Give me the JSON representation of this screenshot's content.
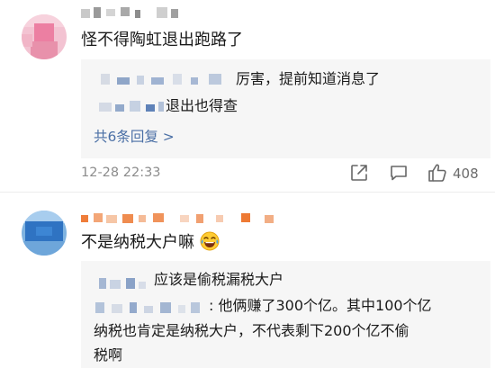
{
  "comments": [
    {
      "text": "怪不得陶虹退出跑路了",
      "replies": [
        {
          "text": "厉害，提前知道消息了"
        },
        {
          "text": "退出也得查"
        }
      ],
      "more_replies": "共6条回复 >",
      "time": "12-28 22:33",
      "likes": "408"
    },
    {
      "text": "不是纳税大户嘛",
      "emoji": "tears-of-joy-emoji",
      "replies": [
        {
          "line1": "应该是偷税漏税大户",
          "line2": ": 他俩赚了300个亿。其中100个亿",
          "line3": "纳税也肯定是纳税大户，不代表剩下200个亿不偷",
          "line4": "税啊"
        }
      ]
    }
  ],
  "icons": [
    "share-icon",
    "comment-icon",
    "like-icon"
  ],
  "colors": {
    "link": "#4a6fa5",
    "meta": "#8c8c8c",
    "reply_bg": "#f6f6f6"
  }
}
